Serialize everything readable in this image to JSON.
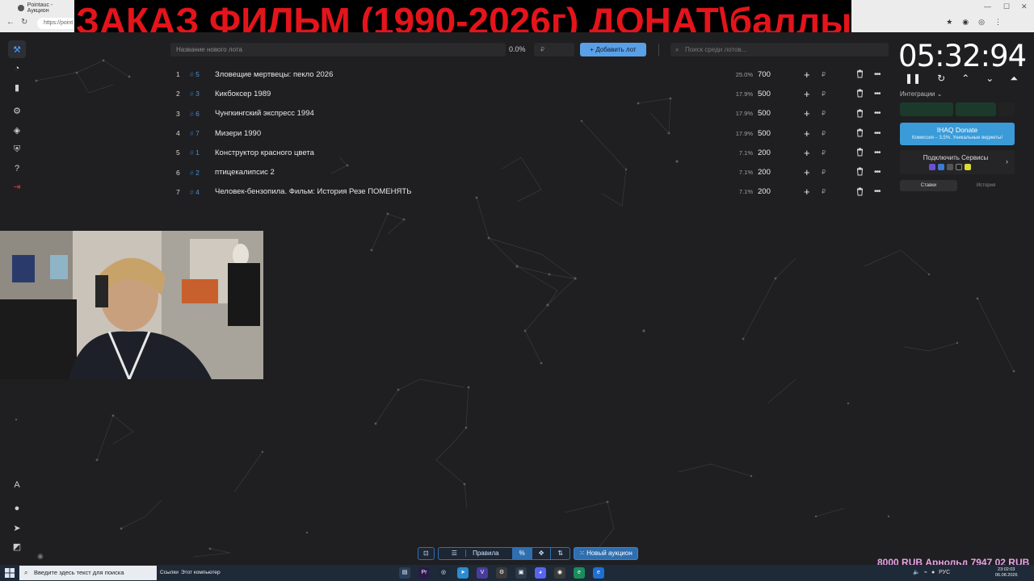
{
  "browser": {
    "tab_title": "Pointauc - Аукцион",
    "url": "https://point"
  },
  "banner": {
    "text": "ЗАКАЗ ФИЛЬМ (1990-2026г) ДОНАТ\\баллы"
  },
  "toolbar": {
    "lot_placeholder": "Название нового лота",
    "percent": "0.0%",
    "currency": "₽",
    "add_label": "Добавить лот",
    "search_placeholder": "Поиск среди лотов..."
  },
  "lots": [
    {
      "num": "1",
      "id": "5",
      "name": "Зловещие мертвецы: пекло 2026",
      "pct": "25.0%",
      "amount": "700"
    },
    {
      "num": "2",
      "id": "3",
      "name": "Кикбоксер 1989",
      "pct": "17.9%",
      "amount": "500"
    },
    {
      "num": "3",
      "id": "6",
      "name": "Чунгкингский экспресс 1994",
      "pct": "17.9%",
      "amount": "500"
    },
    {
      "num": "4",
      "id": "7",
      "name": "Мизери 1990",
      "pct": "17.9%",
      "amount": "500"
    },
    {
      "num": "5",
      "id": "1",
      "name": "Конструктор красного цвета",
      "pct": "7.1%",
      "amount": "200"
    },
    {
      "num": "6",
      "id": "2",
      "name": "птицекалипсис 2",
      "pct": "7.1%",
      "amount": "200"
    },
    {
      "num": "7",
      "id": "4",
      "name": "Человек-бензопила. Фильм: История Резе ПОМЕНЯТЬ",
      "pct": "7.1%",
      "amount": "200"
    }
  ],
  "lot_hash": "#",
  "lot_currency": "₽",
  "timer": {
    "display": "05:32:94"
  },
  "integrations": {
    "label": "Интеграции ⌄"
  },
  "donate": {
    "title": "IHAQ Donate",
    "subtitle": "Комиссия – 3,5%. Уникальные виджеты!"
  },
  "connect": {
    "title": "Подключить Сервисы"
  },
  "history_tabs": {
    "bids": "Ставки",
    "history": "История"
  },
  "bottom": {
    "rules": "Правила",
    "new_auction": "Новый аукцион"
  },
  "ticker": {
    "text": "8000 RUB   Арнольд   7947 02 RUB"
  },
  "taskbar": {
    "search_placeholder": "Введите здесь текст для поиска",
    "links": "Ссылки",
    "computer": "Этот компьютер",
    "lang": "РУС",
    "time": "23:02:03",
    "date": "06.08.2026"
  },
  "colors": {
    "accent": "#5aa0e6",
    "banner_text": "#e4141b",
    "lot_id": "#4e8fd6",
    "donate": "#3a9bd8"
  }
}
